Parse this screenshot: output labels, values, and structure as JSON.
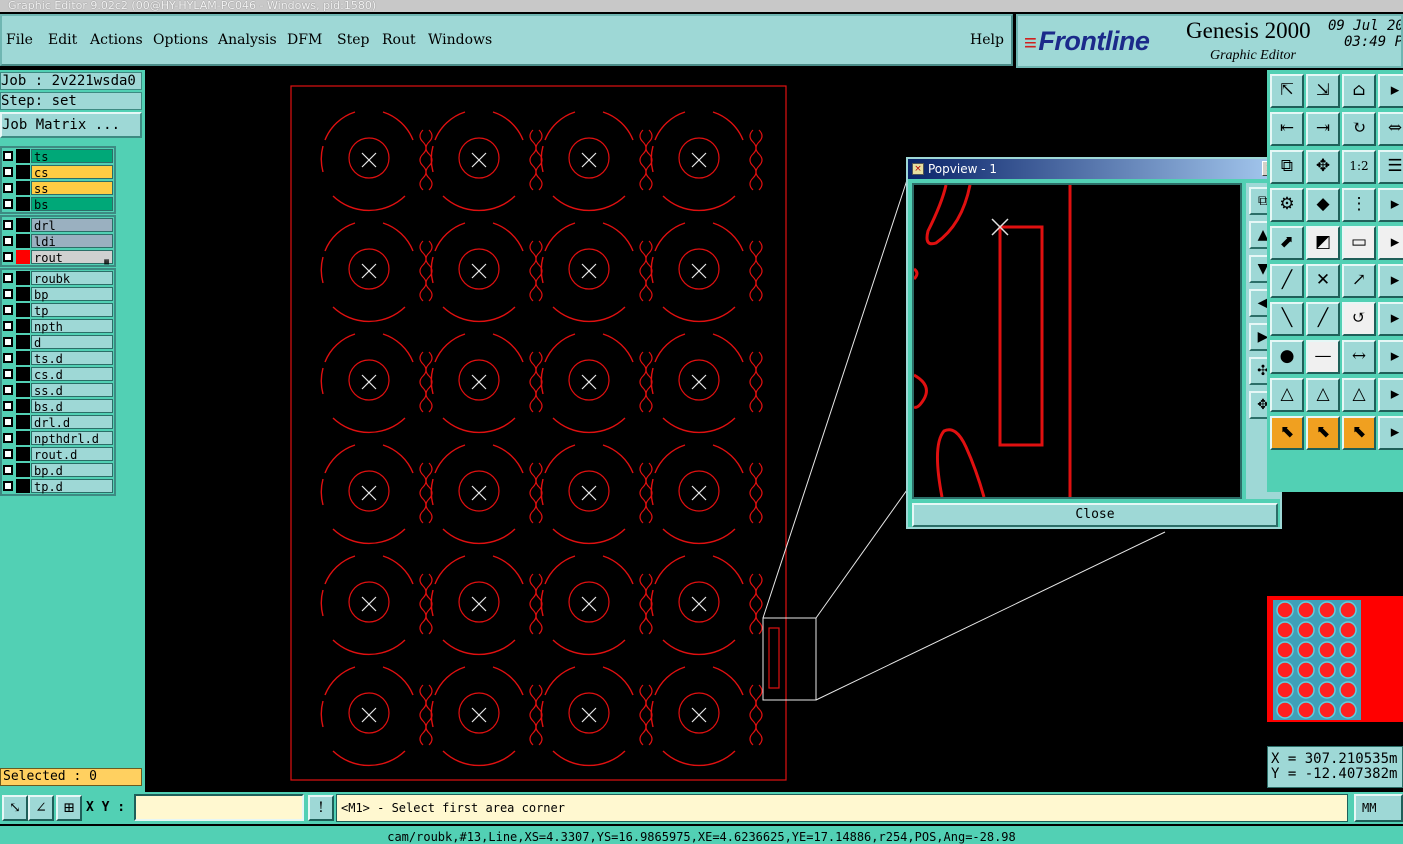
{
  "window": {
    "title": "Graphic Editor 9.02c2 (00@HY-HYLAM-PC046 - Windows, pid:1580)"
  },
  "menu": {
    "file": "File",
    "edit": "Edit",
    "actions": "Actions",
    "options": "Options",
    "analysis": "Analysis",
    "dfm": "DFM",
    "step": "Step",
    "rout": "Rout",
    "windows": "Windows",
    "help": "Help"
  },
  "brand": {
    "logo": "Frontline",
    "product": "Genesis 2000",
    "subtitle": "Graphic Editor",
    "date": "09 Jul 20",
    "time": "03:49 P"
  },
  "job": {
    "job_line": "Job : 2v221wsda0",
    "step_line": "Step: set",
    "matrix_button": "Job Matrix ..."
  },
  "layers": {
    "group1": [
      {
        "name": "ts",
        "color": "#00a878"
      },
      {
        "name": "cs",
        "color": "#ffcc44"
      },
      {
        "name": "ss",
        "color": "#ffcc44"
      },
      {
        "name": "bs",
        "color": "#00a878"
      }
    ],
    "group2": [
      {
        "name": "drl",
        "color": "#9ab0c0"
      },
      {
        "name": "ldi",
        "color": "#9ab0c0"
      },
      {
        "name": "rout",
        "color": "#d0d0d0"
      }
    ],
    "group3": [
      {
        "name": "roubk"
      },
      {
        "name": "bp"
      },
      {
        "name": "tp"
      },
      {
        "name": "npth"
      },
      {
        "name": "d"
      },
      {
        "name": "ts.d"
      },
      {
        "name": "cs.d"
      },
      {
        "name": "ss.d"
      },
      {
        "name": "bs.d"
      },
      {
        "name": "drl.d"
      },
      {
        "name": "npthdrl.d"
      },
      {
        "name": "rout.d"
      },
      {
        "name": "bp.d"
      },
      {
        "name": "tp.d"
      }
    ]
  },
  "selected": "Selected : 0",
  "popview": {
    "title": "Popview - 1",
    "close_x": "✕",
    "close_button": "Close"
  },
  "command": {
    "xy_label": "X Y :",
    "xy_value": "",
    "prompt": "<M1> - Select first area corner",
    "units": "MM"
  },
  "coords": {
    "x": "X = 307.210535m",
    "y": "Y = -12.407382m"
  },
  "status": "cam/roubk,#13,Line,XS=4.3307,YS=16.9865975,XE=4.6236625,YE=17.14886,r254,POS,Ang=-28.98",
  "colors": {
    "panel": "#52d0b4",
    "light": "#9ed8d6",
    "trace": "#e01010",
    "accent": "#1b2a8a"
  },
  "icons": {
    "tool_buttons": [
      "zoom-home-icon",
      "zoom-back-icon",
      "home-icon",
      "more-icon",
      "pan-left-icon",
      "pan-right-icon",
      "redraw-icon",
      "scale-icon",
      "window-icon",
      "center-icon",
      "ratio-icon",
      "layer-icon",
      "snap-icon",
      "marker-icon",
      "net-icon",
      "more2-icon",
      "measure-icon",
      "pointer-icon",
      "ruler-icon",
      "more3-icon",
      "line-icon",
      "cross-icon",
      "arc-icon",
      "more4-icon",
      "edit-line-icon",
      "diagonal-icon",
      "rotate-icon",
      "more5-icon",
      "pad-icon",
      "minus-icon",
      "width-icon",
      "more6-icon",
      "triangle-icon",
      "triangle2-icon",
      "triangle3-icon",
      "more7-icon",
      "select-icon",
      "select2-icon",
      "select3-icon",
      "more8-icon"
    ]
  }
}
